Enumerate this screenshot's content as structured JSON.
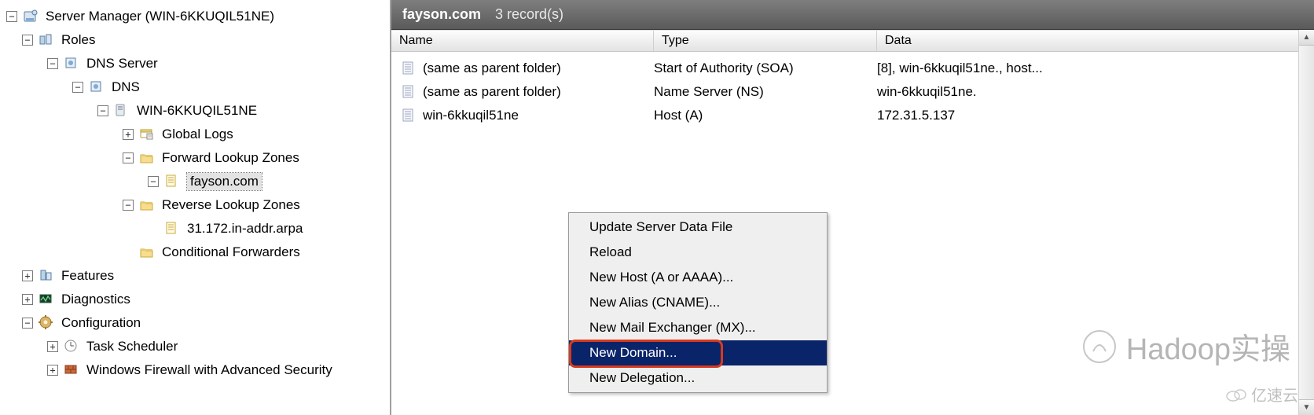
{
  "tree": {
    "root": "Server Manager (WIN-6KKUQIL51NE)",
    "roles": "Roles",
    "dns_server": "DNS Server",
    "dns": "DNS",
    "host": "WIN-6KKUQIL51NE",
    "global_logs": "Global Logs",
    "fwd_zones": "Forward Lookup Zones",
    "zone_selected": "fayson.com",
    "rev_zones": "Reverse Lookup Zones",
    "rev_zone1": "31.172.in-addr.arpa",
    "cond_fwd": "Conditional Forwarders",
    "features": "Features",
    "diagnostics": "Diagnostics",
    "configuration": "Configuration",
    "task_sched": "Task Scheduler",
    "firewall": "Windows Firewall with Advanced Security"
  },
  "header": {
    "zone": "fayson.com",
    "count": "3 record(s)"
  },
  "columns": {
    "name": "Name",
    "type": "Type",
    "data": "Data"
  },
  "records": [
    {
      "name": "(same as parent folder)",
      "type": "Start of Authority (SOA)",
      "data": "[8], win-6kkuqil51ne., host..."
    },
    {
      "name": "(same as parent folder)",
      "type": "Name Server (NS)",
      "data": "win-6kkuqil51ne."
    },
    {
      "name": "win-6kkuqil51ne",
      "type": "Host (A)",
      "data": "172.31.5.137"
    }
  ],
  "context_menu": {
    "items": [
      "Update Server Data File",
      "Reload",
      "New Host (A or AAAA)...",
      "New Alias (CNAME)...",
      "New Mail Exchanger (MX)...",
      "New Domain...",
      "New Delegation..."
    ],
    "highlighted_index": 5
  },
  "watermark_main": "Hadoop实操",
  "watermark_sub": "亿速云"
}
